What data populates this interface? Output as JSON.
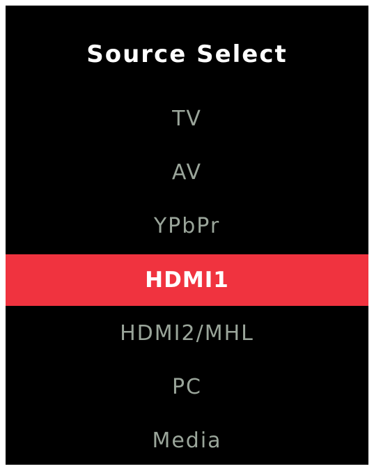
{
  "menu": {
    "title": "Source Select",
    "items": [
      {
        "label": "TV"
      },
      {
        "label": "AV"
      },
      {
        "label": "YPbPr"
      },
      {
        "label": "HDMI1"
      },
      {
        "label": "HDMI2/MHL"
      },
      {
        "label": "PC"
      },
      {
        "label": "Media"
      }
    ],
    "selected_label": "HDMI1"
  },
  "colors": {
    "background": "#000000",
    "highlight": "#f0333f",
    "item_text": "#9aa59a",
    "selected_text": "#ffffff"
  }
}
